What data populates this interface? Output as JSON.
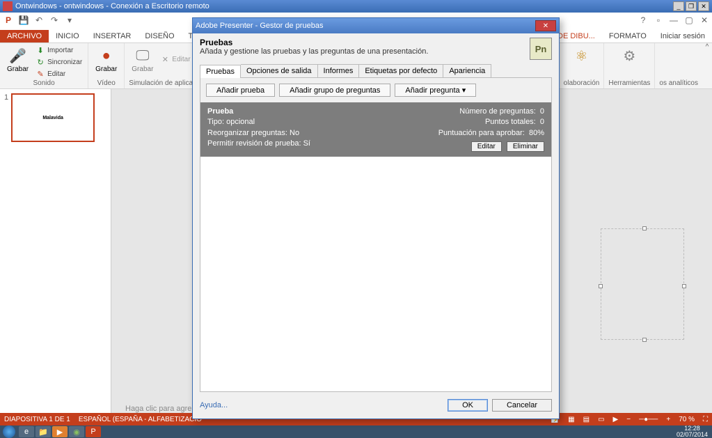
{
  "rdp": {
    "title": "Ontwindows - ontwindows - Conexión a Escritorio remoto"
  },
  "ribbon_tabs": {
    "file": "ARCHIVO",
    "home": "INICIO",
    "insert": "INSERTAR",
    "design": "DISEÑO",
    "trans": "TRANSIC",
    "draw_tools": "RRAMIENTAS DE DIBU...",
    "format": "FORMATO",
    "signin": "Iniciar sesión"
  },
  "ribbon": {
    "grabar1": "Grabar",
    "importar": "Importar",
    "sincronizar": "Sincronizar",
    "editar": "Editar",
    "sonido": "Sonido",
    "grabar2": "Grabar",
    "video": "Vídeo",
    "grabar3": "Grabar",
    "editar2": "Editar",
    "sim": "Simulación de aplicación",
    "collab": "olaboración",
    "tools": "Herramientas",
    "analytics": "os analíticos"
  },
  "slide": {
    "num": "1",
    "title": "Malavida"
  },
  "notes_hint": "Haga clic para agre",
  "status": {
    "slide": "DIAPOSITIVA 1 DE 1",
    "lang": "ESPAÑOL (ESPAÑA - ALFABETIZACIÓ",
    "zoom": "70 %"
  },
  "taskbar": {
    "time": "12:28",
    "date": "02/07/2014"
  },
  "dialog": {
    "title": "Adobe Presenter - Gestor de pruebas",
    "heading": "Pruebas",
    "subheading": "Añada y gestione las pruebas y las preguntas de una presentación.",
    "logo": "Pn",
    "tabs": {
      "pruebas": "Pruebas",
      "salida": "Opciones de salida",
      "informes": "Informes",
      "etiquetas": "Etiquetas por defecto",
      "apariencia": "Apariencia"
    },
    "buttons": {
      "add_quiz": "Añadir prueba",
      "add_group": "Añadir grupo de preguntas",
      "add_q": "Añadir pregunta"
    },
    "quiz": {
      "title": "Prueba",
      "tipo_label": "Tipo:",
      "tipo_val": "opcional",
      "reorg_label": "Reorganizar preguntas:",
      "reorg_val": "No",
      "rev_label": "Permitir revisión de prueba:",
      "rev_val": "Sí",
      "npreg_label": "Número de preguntas:",
      "npreg_val": "0",
      "puntos_label": "Puntos totales:",
      "puntos_val": "0",
      "score_label": "Puntuación para aprobar:",
      "score_val": "80%",
      "edit": "Editar",
      "del": "Eliminar"
    },
    "help": "Ayuda...",
    "ok": "OK",
    "cancel": "Cancelar"
  }
}
